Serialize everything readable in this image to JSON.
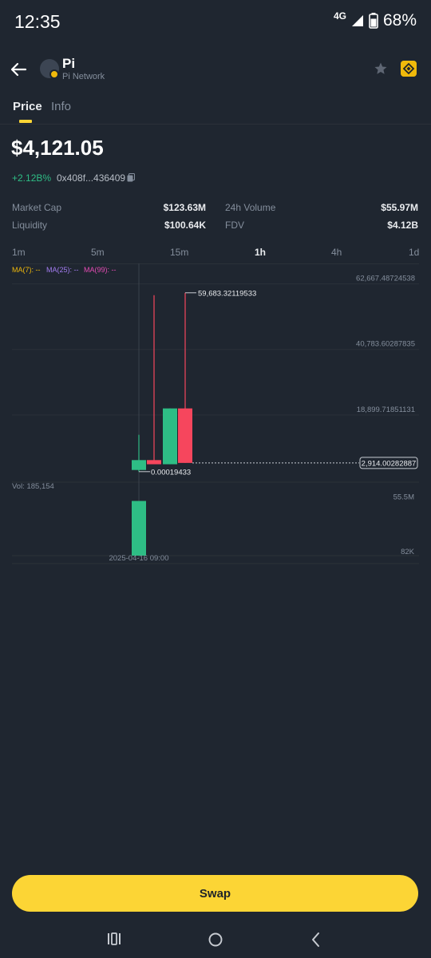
{
  "status_bar": {
    "time": "12:35",
    "network": "4G",
    "battery": "68%"
  },
  "token": {
    "name": "Pi",
    "network": "Pi Network"
  },
  "tabs": [
    {
      "label": "Price"
    },
    {
      "label": "Info"
    }
  ],
  "price": "$4,121.05",
  "change": "+2.12B%",
  "address": "0x408f...436409",
  "stats": {
    "market_cap_label": "Market Cap",
    "market_cap_value": "$123.63M",
    "volume_label": "24h Volume",
    "volume_value": "$55.97M",
    "liquidity_label": "Liquidity",
    "liquidity_value": "$100.64K",
    "fdv_label": "FDV",
    "fdv_value": "$4.12B"
  },
  "intervals": [
    "1m",
    "5m",
    "15m",
    "1h",
    "4h",
    "1d"
  ],
  "active_interval": "1h",
  "ma": {
    "ma7": "MA(7): --",
    "ma25": "MA(25): --",
    "ma99": "MA(99): --"
  },
  "colors": {
    "up": "#2ebd85",
    "down": "#f6465d",
    "accent": "#fcd535",
    "ma7": "#f0b90b",
    "ma25": "#a37cf0",
    "ma99": "#e64cb5"
  },
  "chart_data": {
    "type": "candlestick",
    "price_ticks": [
      "62,667.48724538",
      "40,783.60287835",
      "18,899.71851131"
    ],
    "price_tick_values": [
      62667.48724538,
      40783.60287835,
      18899.71851131
    ],
    "ylim": [
      -2984.1,
      66815
    ],
    "high_label": "59,683.32119533",
    "high_value": 59683.32119533,
    "low_label": "0.00019433",
    "low_value": 0.00019433,
    "last_price_label": "2,914.00282887",
    "last_price_value": 2914.00282887,
    "candles": [
      {
        "open": 560,
        "close": 3860,
        "high": 12300,
        "low": 0.00019433,
        "dir": "up"
      },
      {
        "open": 3860,
        "close": 2470,
        "high": 58900,
        "low": 2470,
        "dir": "down"
      },
      {
        "open": 2470,
        "close": 21100,
        "high": 21100,
        "low": 2470,
        "dir": "up"
      },
      {
        "open": 21100,
        "close": 2914.00282887,
        "high": 59683.32119533,
        "low": 2914.00282887,
        "dir": "down"
      }
    ],
    "volume_label": "Vol: 185,154",
    "volume_ticks": [
      "55.5M",
      "82K"
    ],
    "volume_tick_values": [
      55500000,
      82000
    ],
    "volume_ylim": [
      0,
      63200000
    ],
    "volume_bars": [
      {
        "value": 55500000,
        "dir": "up"
      }
    ],
    "x_label": "2025-04-16 09:00"
  },
  "swap_label": "Swap"
}
